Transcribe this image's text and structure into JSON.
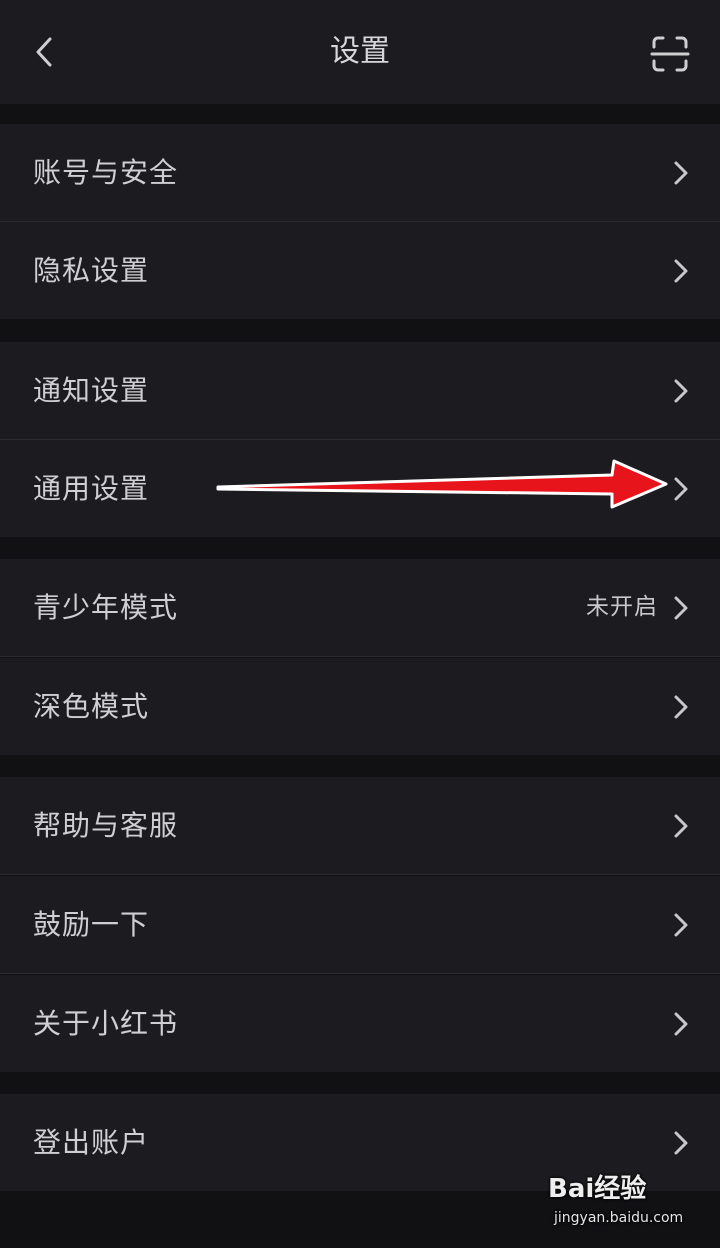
{
  "header": {
    "title": "设置",
    "back_icon": "chevron-left-icon",
    "scan_icon": "scan-icon"
  },
  "settings_groups": [
    {
      "items": [
        {
          "label": "账号与安全",
          "value": ""
        },
        {
          "label": "隐私设置",
          "value": ""
        }
      ]
    },
    {
      "items": [
        {
          "label": "通知设置",
          "value": ""
        },
        {
          "label": "通用设置",
          "value": ""
        }
      ]
    },
    {
      "items": [
        {
          "label": "青少年模式",
          "value": "未开启"
        },
        {
          "label": "深色模式",
          "value": ""
        }
      ]
    },
    {
      "items": [
        {
          "label": "帮助与客服",
          "value": ""
        },
        {
          "label": "鼓励一下",
          "value": ""
        },
        {
          "label": "关于小红书",
          "value": ""
        }
      ]
    },
    {
      "items": [
        {
          "label": "登出账户",
          "value": ""
        }
      ]
    }
  ],
  "annotation": {
    "type": "arrow",
    "color": "#e8141c",
    "points_to": "通用设置"
  },
  "watermark": {
    "brand": "Bai经验",
    "url": "jingyan.baidu.com"
  },
  "colors": {
    "background": "#111114",
    "row_background": "#1c1c20",
    "text": "#cfcfd2",
    "divider": "#2b2b30"
  }
}
